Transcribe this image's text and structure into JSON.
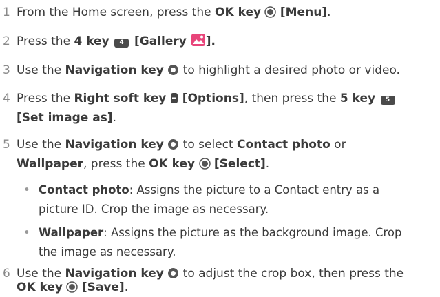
{
  "steps": [
    {
      "num": "1",
      "a": "From the Home screen, press the ",
      "b": "OK key",
      "c": " ",
      "d": "[Menu]",
      "e": "."
    },
    {
      "num": "2",
      "a": "Press the ",
      "b": "4 key",
      "key": "4",
      "d": " [Gallery ",
      "e": "]."
    },
    {
      "num": "3",
      "a": "Use the ",
      "b": "Navigation key",
      "c": " to highlight a desired photo or video."
    },
    {
      "num": "4",
      "a": "Press the ",
      "b": "Right soft key",
      "d": " [Options]",
      "e": ", then press the ",
      "f": "5 key",
      "key": "5",
      "g": "[Set image as]",
      "h": "."
    },
    {
      "num": "5",
      "a": "Use the ",
      "b": "Navigation key",
      "c": " to select ",
      "d": "Contact photo",
      "e": " or",
      "f": "Wallpaper",
      "g": ", press the ",
      "h": "OK key",
      "i": "[Select]",
      "j": "."
    },
    {
      "num": "6",
      "a": "Use the ",
      "b": "Navigation key",
      "c": " to adjust the crop box, then press the",
      "d": "OK key",
      "e": "[Save]",
      "f": "."
    }
  ],
  "bullets": [
    {
      "bold": "Contact photo",
      "rest": ": Assigns the picture to a Contact entry as a",
      "line2": "picture ID. Crop the image as necessary."
    },
    {
      "bold": "Wallpaper",
      "rest": ": Assigns the picture as the background image. Crop",
      "line2": "the image as necessary."
    }
  ],
  "bullet_mark": "•",
  "icons": [
    "ok-key-icon",
    "gallery-app-icon",
    "navigation-key-icon",
    "right-soft-key-icon",
    "numeric-key-icon"
  ],
  "colors": {
    "text": "#3a3a3a",
    "number": "#8a8a8a",
    "gallery": "#e8457a"
  }
}
